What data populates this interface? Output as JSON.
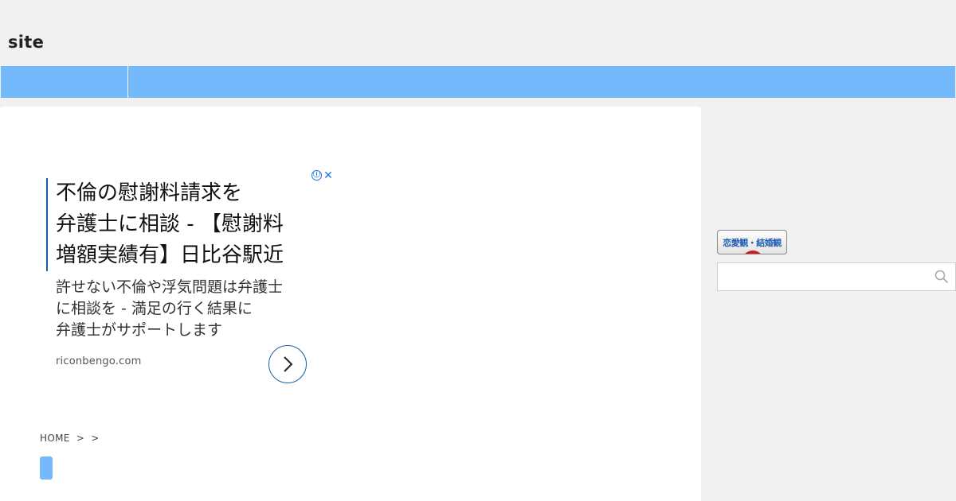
{
  "header": {
    "site_title": "site"
  },
  "nav": {
    "accent_color": "#74b9fb"
  },
  "ad": {
    "info_icon": "ⓘ",
    "close_icon": "✕",
    "headline": [
      "不倫の慰謝料請求を",
      "弁護士に相談 - 【慰謝料",
      "増額実績有】日比谷駅近"
    ],
    "description": [
      "許せない不倫や浮気問題は弁護士",
      "に相談を - 満足の行く結果に",
      "弁護士がサポートします"
    ],
    "domain": "riconbengo.com",
    "cta_icon": "chevron-right-icon"
  },
  "breadcrumb": {
    "items": [
      "HOME",
      ">",
      ">"
    ]
  },
  "sidebar": {
    "banner_text": "恋愛観・結婚観",
    "search_placeholder": "",
    "search_icon": "search-icon"
  }
}
